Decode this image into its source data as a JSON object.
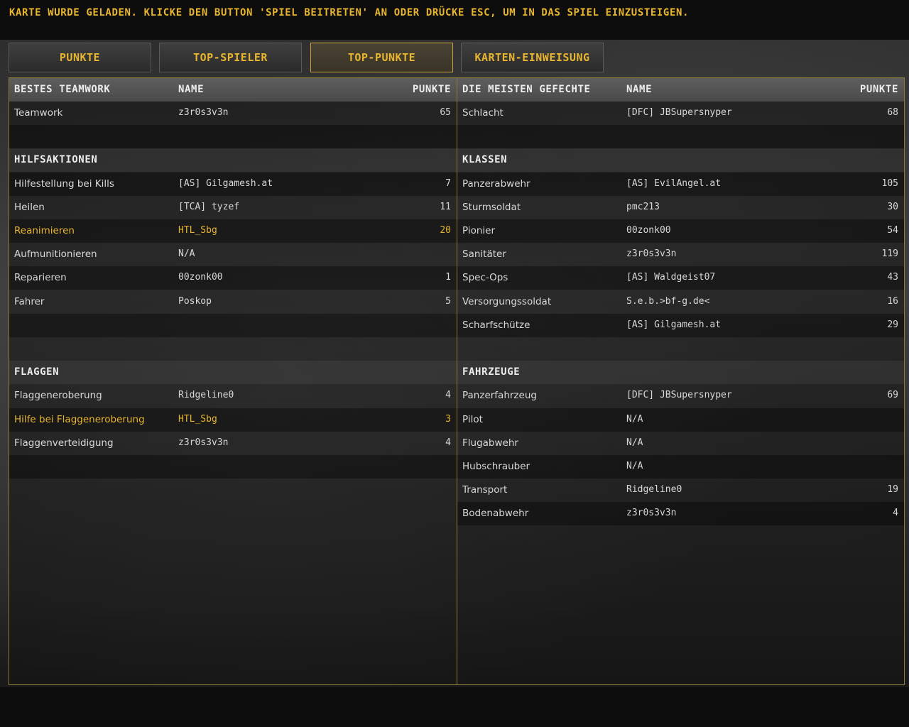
{
  "message": "KARTE WURDE GELADEN. KLICKE DEN BUTTON 'SPIEL BEITRETEN' AN ODER DRÜCKE ESC, UM IN DAS SPIEL EINZUSTEIGEN.",
  "tabs": [
    "PUNKTE",
    "TOP-SPIELER",
    "TOP-PUNKTE",
    "KARTEN-EINWEISUNG"
  ],
  "active_tab": "TOP-PUNKTE",
  "colors": {
    "accent": "#e8b530",
    "border": "#8c7a3a"
  },
  "left": {
    "header": {
      "cat": "BESTES TEAMWORK",
      "name": "NAME",
      "pts": "PUNKTE"
    },
    "rows": [
      {
        "type": "item",
        "cat": "Teamwork",
        "name": "z3r0s3v3n",
        "pts": "65"
      },
      {
        "type": "blank"
      },
      {
        "type": "section",
        "title": "HILFSAKTIONEN"
      },
      {
        "type": "item",
        "cat": "Hilfestellung bei Kills",
        "name": "[AS] Gilgamesh.at",
        "pts": "7"
      },
      {
        "type": "item",
        "cat": "Heilen",
        "name": "[TCA] tyzef",
        "pts": "11"
      },
      {
        "type": "item",
        "cat": "Reanimieren",
        "name": "HTL_Sbg",
        "pts": "20",
        "highlight": true
      },
      {
        "type": "item",
        "cat": "Aufmunitionieren",
        "name": "N/A",
        "pts": ""
      },
      {
        "type": "item",
        "cat": "Reparieren",
        "name": "00zonk00",
        "pts": "1"
      },
      {
        "type": "item",
        "cat": "Fahrer",
        "name": "Poskop",
        "pts": "5"
      },
      {
        "type": "blank"
      },
      {
        "type": "blank"
      },
      {
        "type": "section",
        "title": "FLAGGEN"
      },
      {
        "type": "item",
        "cat": "Flaggeneroberung",
        "name": "Ridgeline0",
        "pts": "4"
      },
      {
        "type": "item",
        "cat": "Hilfe bei Flaggeneroberung",
        "name": "HTL_Sbg",
        "pts": "3",
        "highlight": true
      },
      {
        "type": "item",
        "cat": "Flaggenverteidigung",
        "name": "z3r0s3v3n",
        "pts": "4"
      },
      {
        "type": "blank"
      },
      {
        "type": "blank"
      }
    ]
  },
  "right": {
    "header": {
      "cat": "DIE MEISTEN GEFECHTE",
      "name": "NAME",
      "pts": "PUNKTE"
    },
    "rows": [
      {
        "type": "item",
        "cat": "Schlacht",
        "name": "[DFC] JBSupersnyper",
        "pts": "68"
      },
      {
        "type": "blank"
      },
      {
        "type": "section",
        "title": "KLASSEN"
      },
      {
        "type": "item",
        "cat": "Panzerabwehr",
        "name": "[AS] EvilAngel.at",
        "pts": "105"
      },
      {
        "type": "item",
        "cat": "Sturmsoldat",
        "name": "pmc213",
        "pts": "30"
      },
      {
        "type": "item",
        "cat": "Pionier",
        "name": "00zonk00",
        "pts": "54"
      },
      {
        "type": "item",
        "cat": "Sanitäter",
        "name": "z3r0s3v3n",
        "pts": "119"
      },
      {
        "type": "item",
        "cat": "Spec-Ops",
        "name": "[AS] Waldgeist07",
        "pts": "43"
      },
      {
        "type": "item",
        "cat": "Versorgungssoldat",
        "name": "S.e.b.>bf-g.de<",
        "pts": "16"
      },
      {
        "type": "item",
        "cat": "Scharfschütze",
        "name": "[AS] Gilgamesh.at",
        "pts": "29"
      },
      {
        "type": "blank"
      },
      {
        "type": "section",
        "title": "FAHRZEUGE"
      },
      {
        "type": "item",
        "cat": "Panzerfahrzeug",
        "name": "[DFC] JBSupersnyper",
        "pts": "69"
      },
      {
        "type": "item",
        "cat": "Pilot",
        "name": "N/A",
        "pts": ""
      },
      {
        "type": "item",
        "cat": "Flugabwehr",
        "name": "N/A",
        "pts": ""
      },
      {
        "type": "item",
        "cat": "Hubschrauber",
        "name": "N/A",
        "pts": ""
      },
      {
        "type": "item",
        "cat": "Transport",
        "name": "Ridgeline0",
        "pts": "19"
      },
      {
        "type": "item",
        "cat": "Bodenabwehr",
        "name": "z3r0s3v3n",
        "pts": "4"
      }
    ]
  }
}
